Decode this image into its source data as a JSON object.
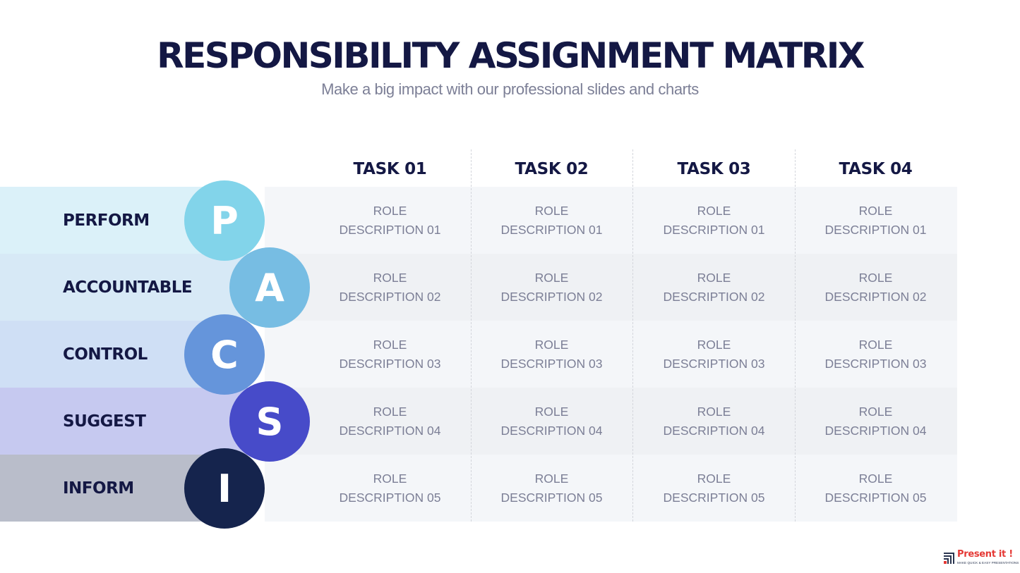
{
  "header": {
    "title": "RESPONSIBILITY ASSIGNMENT MATRIX",
    "subtitle": "Make a big impact with our professional slides and charts"
  },
  "tasks": [
    "TASK 01",
    "TASK 02",
    "TASK 03",
    "TASK 04"
  ],
  "roles": [
    {
      "label": "PERFORM",
      "letter": "P",
      "band_color": "#dbf1f9",
      "circle_color": "#82d4ea"
    },
    {
      "label": "ACCOUNTABLE",
      "letter": "A",
      "band_color": "#d7e9f6",
      "circle_color": "#77bde3"
    },
    {
      "label": "CONTROL",
      "letter": "C",
      "band_color": "#cfdff5",
      "circle_color": "#6595db"
    },
    {
      "label": "SUGGEST",
      "letter": "S",
      "band_color": "#c6c9f0",
      "circle_color": "#474bc9"
    },
    {
      "label": "INFORM",
      "letter": "I",
      "band_color": "#b9bdca",
      "circle_color": "#15244d"
    }
  ],
  "cells": [
    [
      {
        "l1": "ROLE",
        "l2": "DESCRIPTION 01"
      },
      {
        "l1": "ROLE",
        "l2": "DESCRIPTION 01"
      },
      {
        "l1": "ROLE",
        "l2": "DESCRIPTION 01"
      },
      {
        "l1": "ROLE",
        "l2": "DESCRIPTION 01"
      }
    ],
    [
      {
        "l1": "ROLE",
        "l2": "DESCRIPTION 02"
      },
      {
        "l1": "ROLE",
        "l2": "DESCRIPTION 02"
      },
      {
        "l1": "ROLE",
        "l2": "DESCRIPTION 02"
      },
      {
        "l1": "ROLE",
        "l2": "DESCRIPTION 02"
      }
    ],
    [
      {
        "l1": "ROLE",
        "l2": "DESCRIPTION 03"
      },
      {
        "l1": "ROLE",
        "l2": "DESCRIPTION 03"
      },
      {
        "l1": "ROLE",
        "l2": "DESCRIPTION 03"
      },
      {
        "l1": "ROLE",
        "l2": "DESCRIPTION 03"
      }
    ],
    [
      {
        "l1": "ROLE",
        "l2": "DESCRIPTION 04"
      },
      {
        "l1": "ROLE",
        "l2": "DESCRIPTION 04"
      },
      {
        "l1": "ROLE",
        "l2": "DESCRIPTION 04"
      },
      {
        "l1": "ROLE",
        "l2": "DESCRIPTION 04"
      }
    ],
    [
      {
        "l1": "ROLE",
        "l2": "DESCRIPTION 05"
      },
      {
        "l1": "ROLE",
        "l2": "DESCRIPTION 05"
      },
      {
        "l1": "ROLE",
        "l2": "DESCRIPTION 05"
      },
      {
        "l1": "ROLE",
        "l2": "DESCRIPTION 05"
      }
    ]
  ],
  "logo": {
    "name": "Present it !",
    "tagline": "MAKE QUICK & EASY PRESENTATIONS",
    "brand_color": "#e53935"
  }
}
